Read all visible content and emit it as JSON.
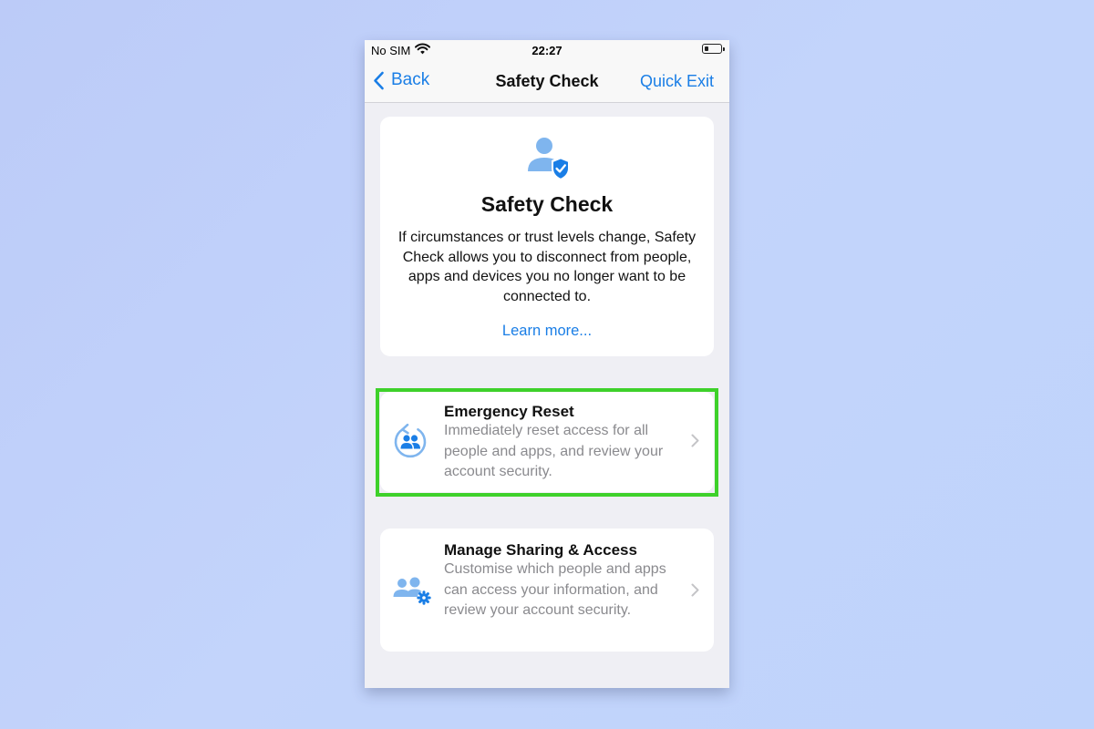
{
  "status_bar": {
    "carrier": "No SIM",
    "time": "22:27"
  },
  "nav": {
    "back_label": "Back",
    "title": "Safety Check",
    "quick_exit_label": "Quick Exit"
  },
  "intro": {
    "title": "Safety Check",
    "description": "If circumstances or trust levels change, Safety Check allows you to disconnect from people, apps and devices you no longer want to be connected to.",
    "learn_more": "Learn more..."
  },
  "options": {
    "emergency_reset": {
      "title": "Emergency Reset",
      "description": "Immediately reset access for all people and apps, and review your account security.",
      "icon": "people-reset-icon"
    },
    "manage_sharing": {
      "title": "Manage Sharing & Access",
      "description": "Customise which people and apps can access your information, and review your account security.",
      "icon": "people-settings-icon"
    }
  },
  "colors": {
    "accent": "#1a7ee6",
    "icon_light_blue": "#7fb5ee",
    "highlight_green": "#3ed12a",
    "secondary_text": "#8a8a8e",
    "background": "#efeff4"
  }
}
